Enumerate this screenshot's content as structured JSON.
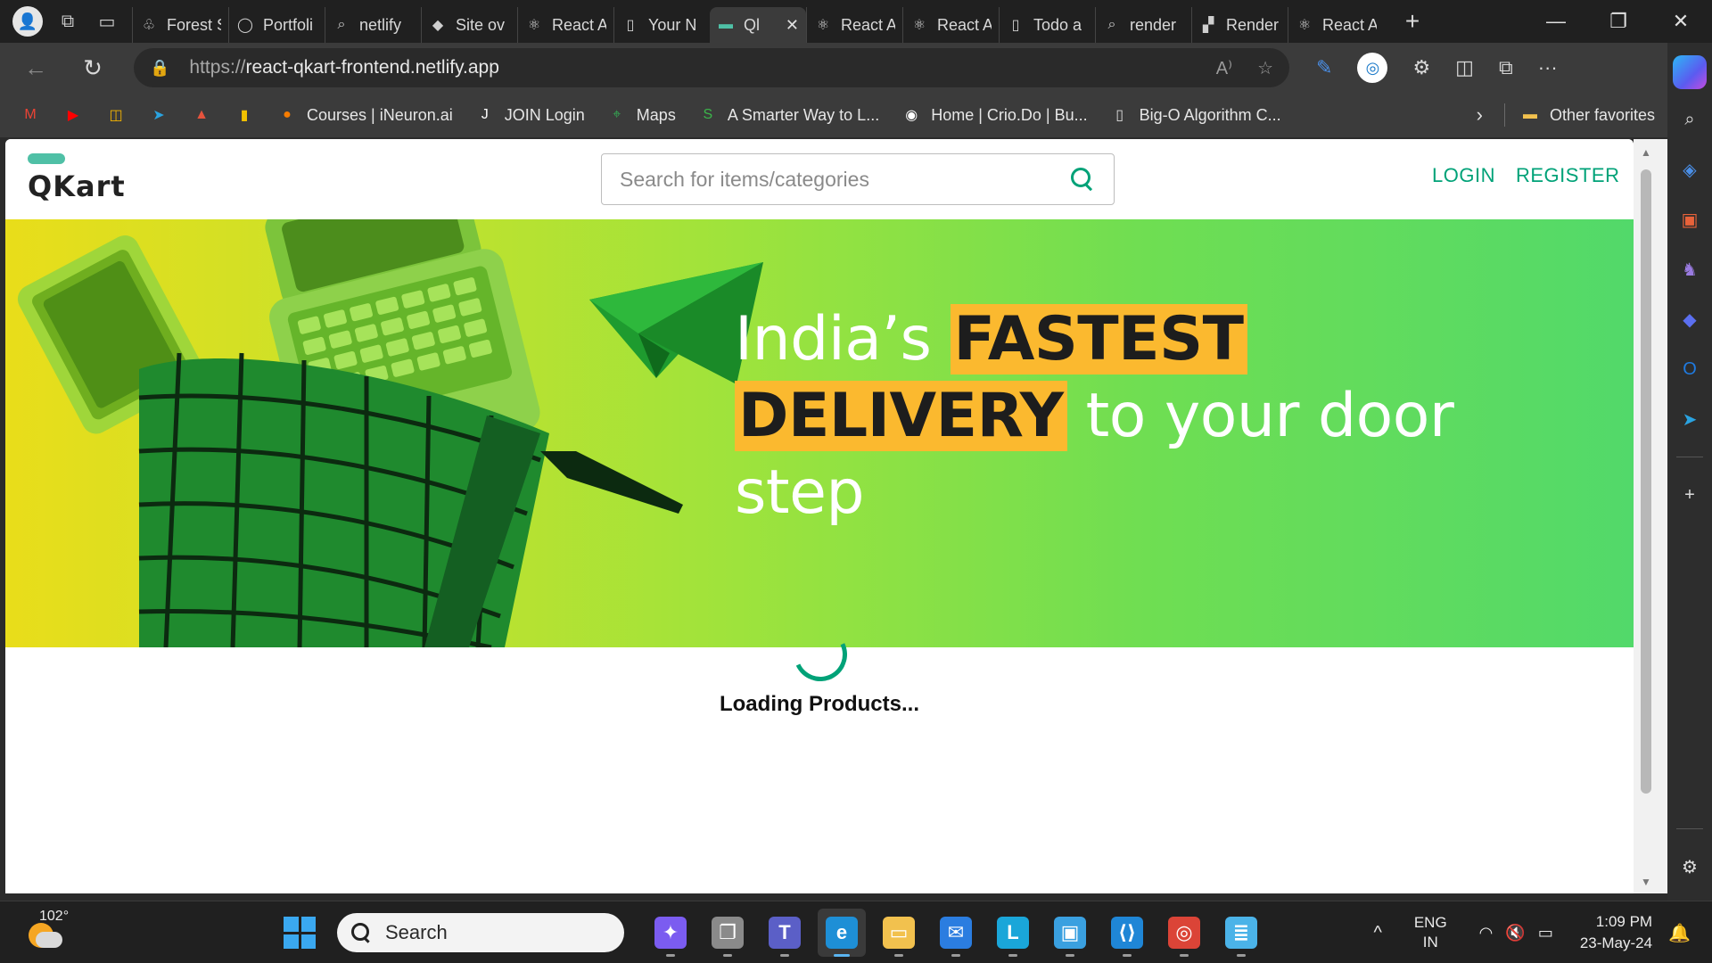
{
  "browser": {
    "tabs": [
      {
        "label": "Forest S",
        "icon": "forest-icon",
        "glyph": "♧"
      },
      {
        "label": "Portfoli",
        "icon": "github-icon",
        "glyph": "◯"
      },
      {
        "label": "netlify",
        "icon": "search-icon",
        "glyph": "⌕"
      },
      {
        "label": "Site ov",
        "icon": "netlify-icon",
        "glyph": "◆"
      },
      {
        "label": "React A",
        "icon": "react-icon",
        "glyph": "⚛"
      },
      {
        "label": "Your N",
        "icon": "page-icon",
        "glyph": "▯"
      },
      {
        "label": "Ql",
        "icon": "qkart-icon",
        "glyph": "▬",
        "active": true
      },
      {
        "label": "React A",
        "icon": "react-icon",
        "glyph": "⚛"
      },
      {
        "label": "React A",
        "icon": "react-icon",
        "glyph": "⚛"
      },
      {
        "label": "Todo a",
        "icon": "page-icon",
        "glyph": "▯"
      },
      {
        "label": "render",
        "icon": "search-icon",
        "glyph": "⌕"
      },
      {
        "label": "Render",
        "icon": "render-icon",
        "glyph": "▞"
      },
      {
        "label": "React A",
        "icon": "react-icon",
        "glyph": "⚛"
      }
    ],
    "address": {
      "protocol": "https://",
      "host": "react-qkart-frontend.netlify.app"
    },
    "bookmarks": [
      {
        "label": "",
        "icon": "gmail-icon",
        "glyph": "M",
        "color": "#ea4335"
      },
      {
        "label": "",
        "icon": "youtube-icon",
        "glyph": "▶",
        "color": "#ff0000"
      },
      {
        "label": "",
        "icon": "classroom-icon",
        "glyph": "◫",
        "color": "#f4b400"
      },
      {
        "label": "",
        "icon": "telegram-icon",
        "glyph": "➤",
        "color": "#2aa3e0"
      },
      {
        "label": "",
        "icon": "triangle-icon",
        "glyph": "▲",
        "color": "#e5533d"
      },
      {
        "label": "",
        "icon": "bars-icon",
        "glyph": "▮",
        "color": "#f2c200"
      },
      {
        "label": "Courses | iNeuron.ai",
        "icon": "ineuron-icon",
        "glyph": "●",
        "color": "#f57c00"
      },
      {
        "label": "JOIN Login",
        "icon": "join-icon",
        "glyph": "J",
        "color": "#ffffff"
      },
      {
        "label": "Maps",
        "icon": "maps-icon",
        "glyph": "⌖",
        "color": "#34a853"
      },
      {
        "label": "A Smarter Way to L...",
        "icon": "smarter-icon",
        "glyph": "S",
        "color": "#3bb54a"
      },
      {
        "label": "Home | Crio.Do | Bu...",
        "icon": "crio-icon",
        "glyph": "◉",
        "color": "#ffffff"
      },
      {
        "label": "Big-O Algorithm C...",
        "icon": "page-icon",
        "glyph": "▯",
        "color": "#dddddd"
      }
    ],
    "other_favorites": "Other favorites"
  },
  "header": {
    "logo": "QKart",
    "search_placeholder": "Search for items/categories",
    "login": "LOGIN",
    "register": "REGISTER"
  },
  "hero": {
    "line1_plain": "India’s ",
    "line1_highlight": "FASTEST",
    "line2_highlight": "DELIVERY",
    "line2_plain": " to your door",
    "line3": "step"
  },
  "loading_text": "Loading Products...",
  "taskbar": {
    "temperature": "102°",
    "search_label": "Search",
    "apps": [
      {
        "name": "copilot-app",
        "glyph": "✦",
        "color": "#7b5cf0"
      },
      {
        "name": "task-view-app",
        "glyph": "❐",
        "color": "#8a8a8a"
      },
      {
        "name": "teams-app",
        "glyph": "T",
        "color": "#5b5fc7"
      },
      {
        "name": "edge-app",
        "glyph": "e",
        "color": "#1e8fd6",
        "active": true
      },
      {
        "name": "file-explorer-app",
        "glyph": "▭",
        "color": "#f2c14e"
      },
      {
        "name": "mail-app",
        "glyph": "✉",
        "color": "#2b7de0"
      },
      {
        "name": "l-app",
        "glyph": "L",
        "color": "#1aa6d9"
      },
      {
        "name": "remote-desktop-app",
        "glyph": "▣",
        "color": "#3aa0e0"
      },
      {
        "name": "vscode-app",
        "glyph": "⟨⟩",
        "color": "#1f86d6"
      },
      {
        "name": "chrome-app",
        "glyph": "◎",
        "color": "#db4437"
      },
      {
        "name": "notepad-app",
        "glyph": "≣",
        "color": "#4bb3e8"
      }
    ],
    "lang_line1": "ENG",
    "lang_line2": "IN",
    "time": "1:09 PM",
    "date": "23-May-24"
  }
}
